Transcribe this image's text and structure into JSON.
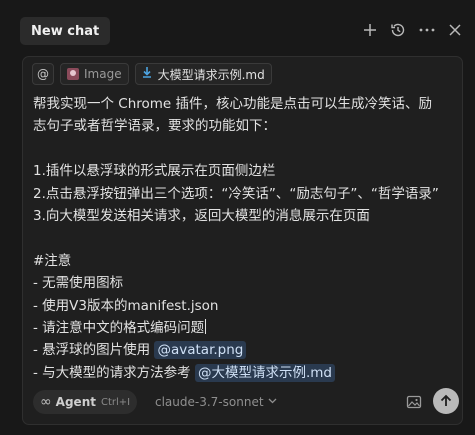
{
  "header": {
    "tab_title": "New chat",
    "icons": [
      "plus-icon",
      "history-icon",
      "more-icon",
      "close-icon"
    ]
  },
  "chips": {
    "mention_symbol": "@",
    "image_label": "Image",
    "file_label": "大模型请求示例.md"
  },
  "message": {
    "lines": [
      "帮我实现一个 Chrome 插件，核心功能是点击可以生成冷笑话、励",
      "志句子或者哲学语录，要求的功能如下：",
      "",
      "1.插件以悬浮球的形式展示在页面侧边栏",
      "2.点击悬浮按钮弹出三个选项：“冷笑话”、“励志句子”、“哲学语录”",
      "3.向大模型发送相关请求，返回大模型的消息展示在页面",
      "",
      "#注意",
      "- 无需使用图标",
      "- 使用V3版本的manifest.json",
      "- 请注意中文的格式编码问题"
    ],
    "avatar_line_prefix": "- 悬浮球的图片使用 ",
    "avatar_mention": "@avatar.png",
    "request_line_prefix": "- 与大模型的请求方法参考 ",
    "request_mention": "@大模型请求示例.md"
  },
  "footer": {
    "agent_icon": "∞",
    "agent_label": "Agent",
    "agent_shortcut": "Ctrl+I",
    "model_name": "claude-3.7-sonnet"
  }
}
